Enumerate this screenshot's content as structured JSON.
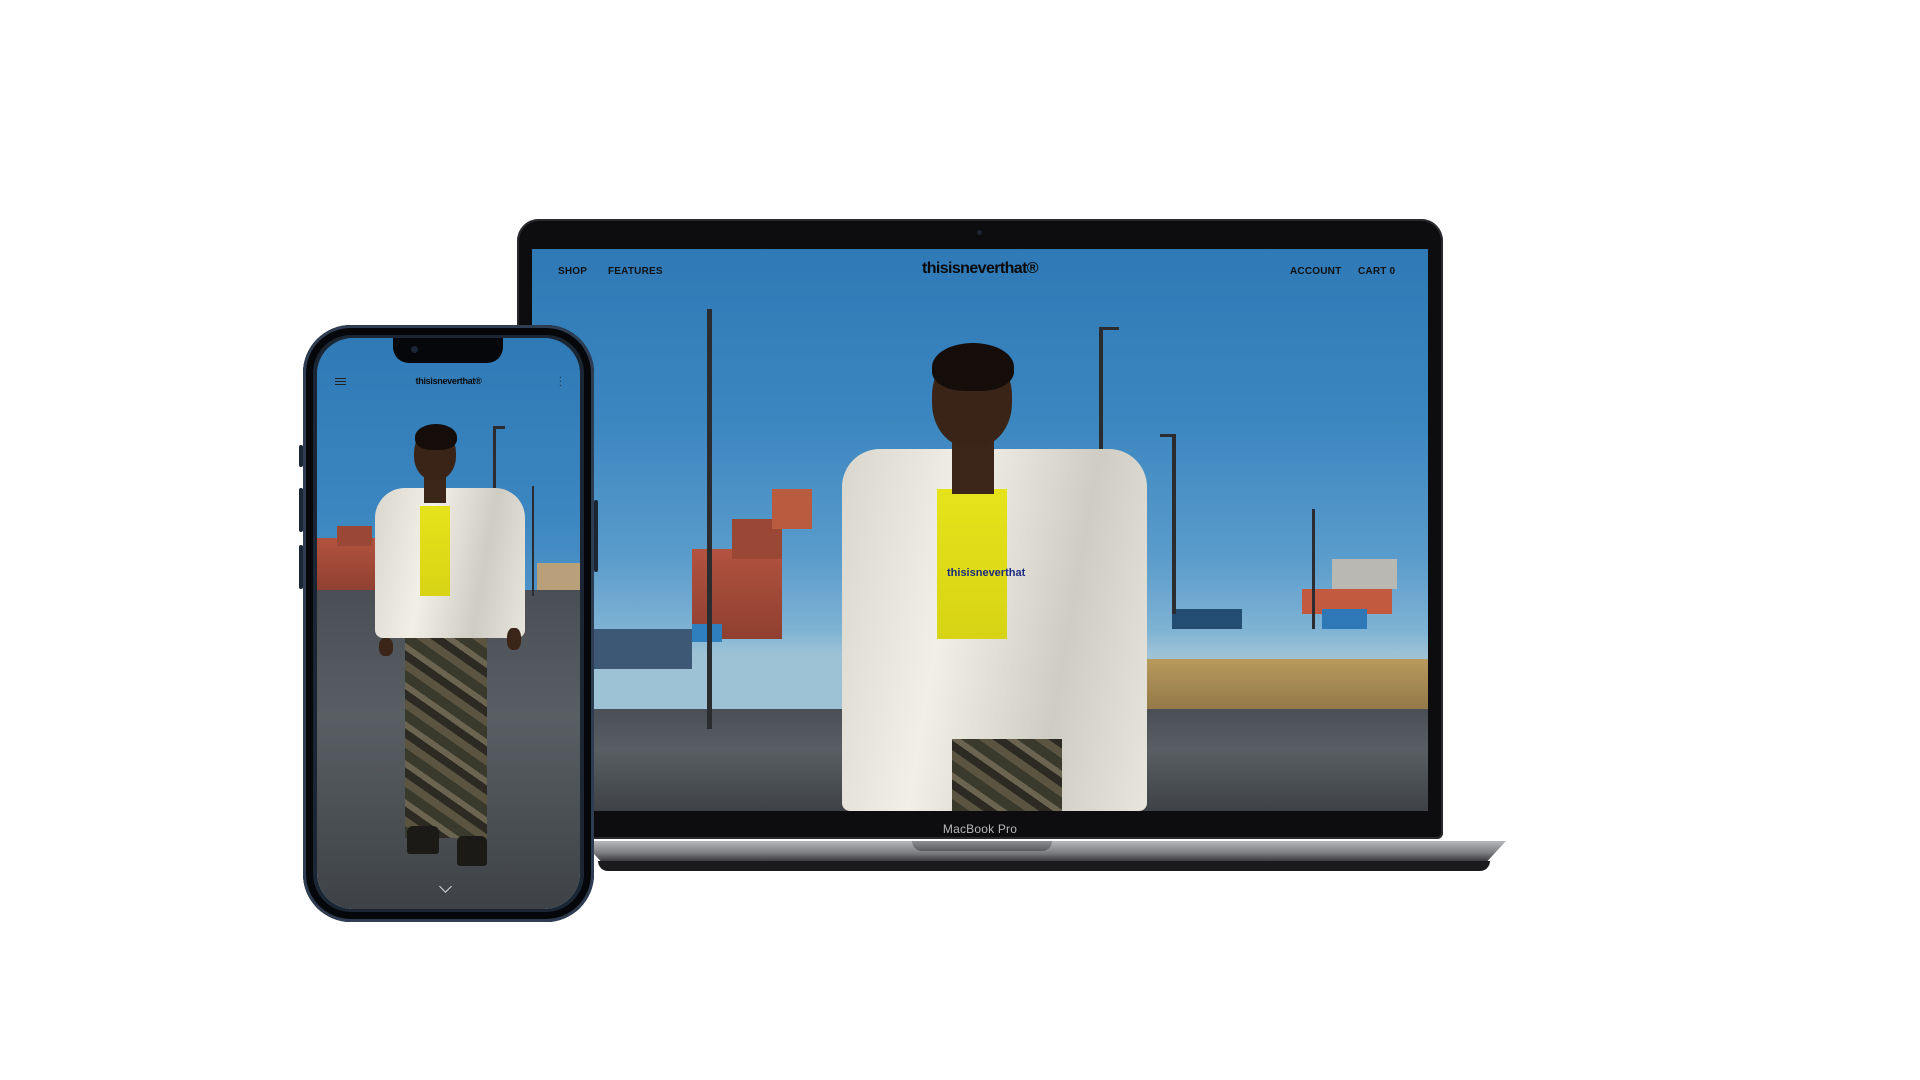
{
  "laptop": {
    "model_label": "MacBook Pro",
    "site": {
      "brand": "thisisneverthat®",
      "nav_left": [
        "SHOP",
        "FEATURES"
      ],
      "nav_right": [
        "ACCOUNT",
        "CART 0"
      ],
      "hero_alt_text_on_shirt": "thisisneverthat"
    }
  },
  "phone": {
    "site": {
      "brand": "thisisneverthat®",
      "menu_icon": "hamburger-menu-icon",
      "more_icon": "kebab-more-icon",
      "scroll_icon": "chevron-down-icon"
    }
  },
  "colors": {
    "sky": "#2f79b6",
    "shirt": "#e6e21a",
    "device_frame": "#0d0d0f",
    "phone_frame": "#1b2634"
  }
}
